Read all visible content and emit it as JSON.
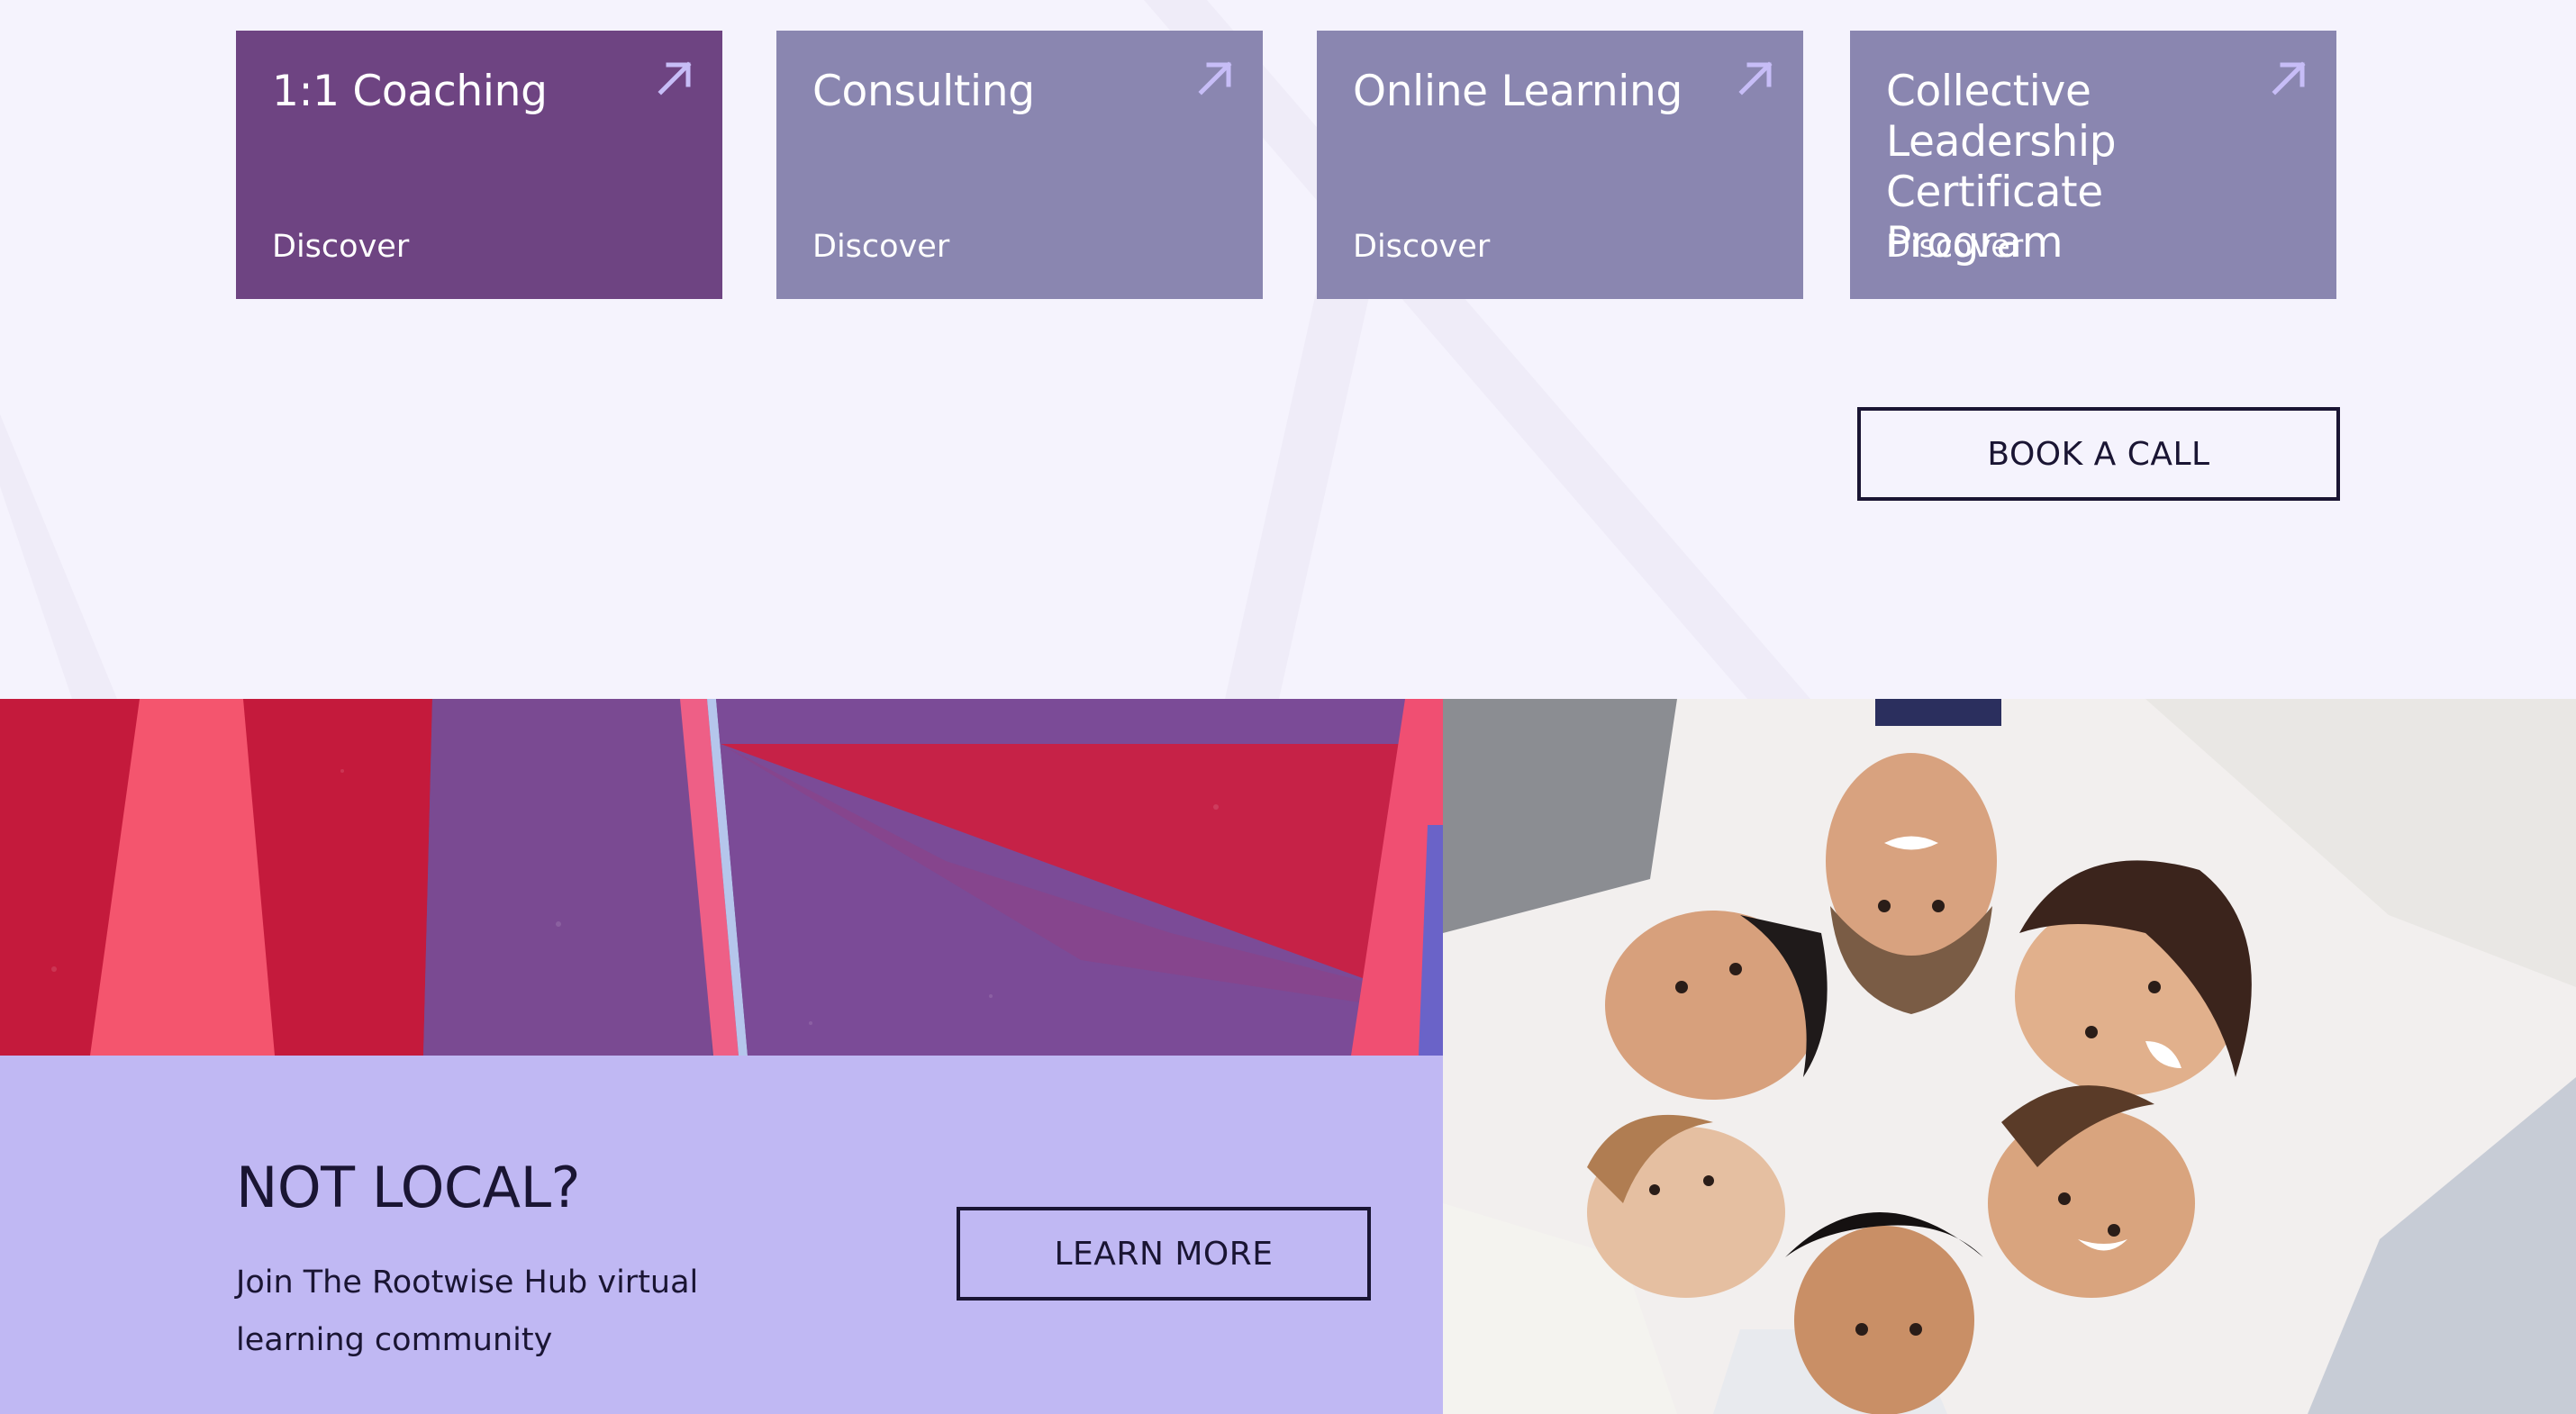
{
  "services": {
    "cards": [
      {
        "title": "1:1 Coaching",
        "link_label": "Discover",
        "active": true
      },
      {
        "title": "Consulting",
        "link_label": "Discover",
        "active": false
      },
      {
        "title": "Online Learning",
        "link_label": "Discover",
        "active": false
      },
      {
        "title": "Collective Leadership Certificate Program",
        "link_label": "Discover",
        "active": false
      }
    ],
    "card_icon": "arrow-up-right-icon"
  },
  "cta": {
    "book_call_label": "BOOK A CALL"
  },
  "not_local": {
    "heading": "NOT LOCAL?",
    "text": "Join The Rootwise Hub virtual learning community",
    "button_label": "LEARN MORE"
  },
  "colors": {
    "page_background": "#f5f3fd",
    "card_active": "#6e4482",
    "card_default": "#8a86b0",
    "arrow_accent": "#c7bdf7",
    "not_local_background": "#c0b8f3",
    "text_dark": "#1a1533"
  }
}
